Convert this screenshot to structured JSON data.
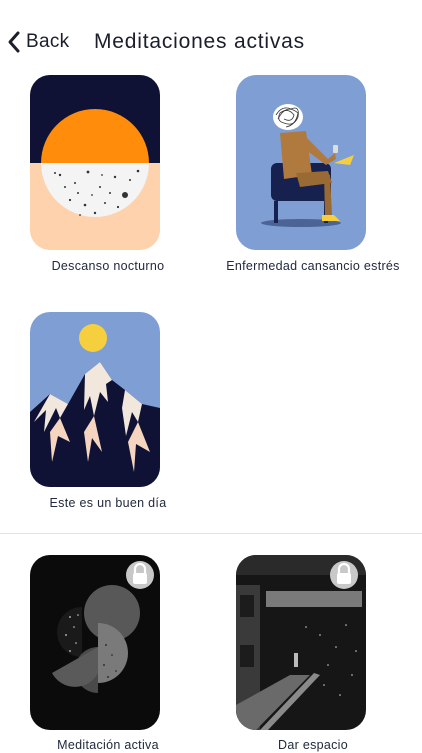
{
  "header": {
    "back_label": "Back",
    "title": "Meditaciones activas"
  },
  "sections": [
    {
      "items": [
        {
          "label": "Descanso nocturno",
          "locked": false,
          "art": "moon-icon"
        },
        {
          "label": "Enfermedad cansancio estrés",
          "locked": false,
          "art": "seated-person-icon"
        },
        {
          "label": "Este es un buen día",
          "locked": false,
          "art": "mountain-icon"
        }
      ]
    },
    {
      "items": [
        {
          "label": "Meditación activa",
          "locked": true,
          "art": "abstract-shapes-icon"
        },
        {
          "label": "Dar espacio",
          "locked": true,
          "art": "room-icon"
        }
      ]
    }
  ],
  "colors": {
    "navy": "#0f1234",
    "orange": "#ff8c0a",
    "peach": "#fdd2ad",
    "blue": "#7f9fd4",
    "yellow": "#f6cf3f",
    "dark_card": "#0b0b0b",
    "lock_bg": "#c8c8c8"
  }
}
